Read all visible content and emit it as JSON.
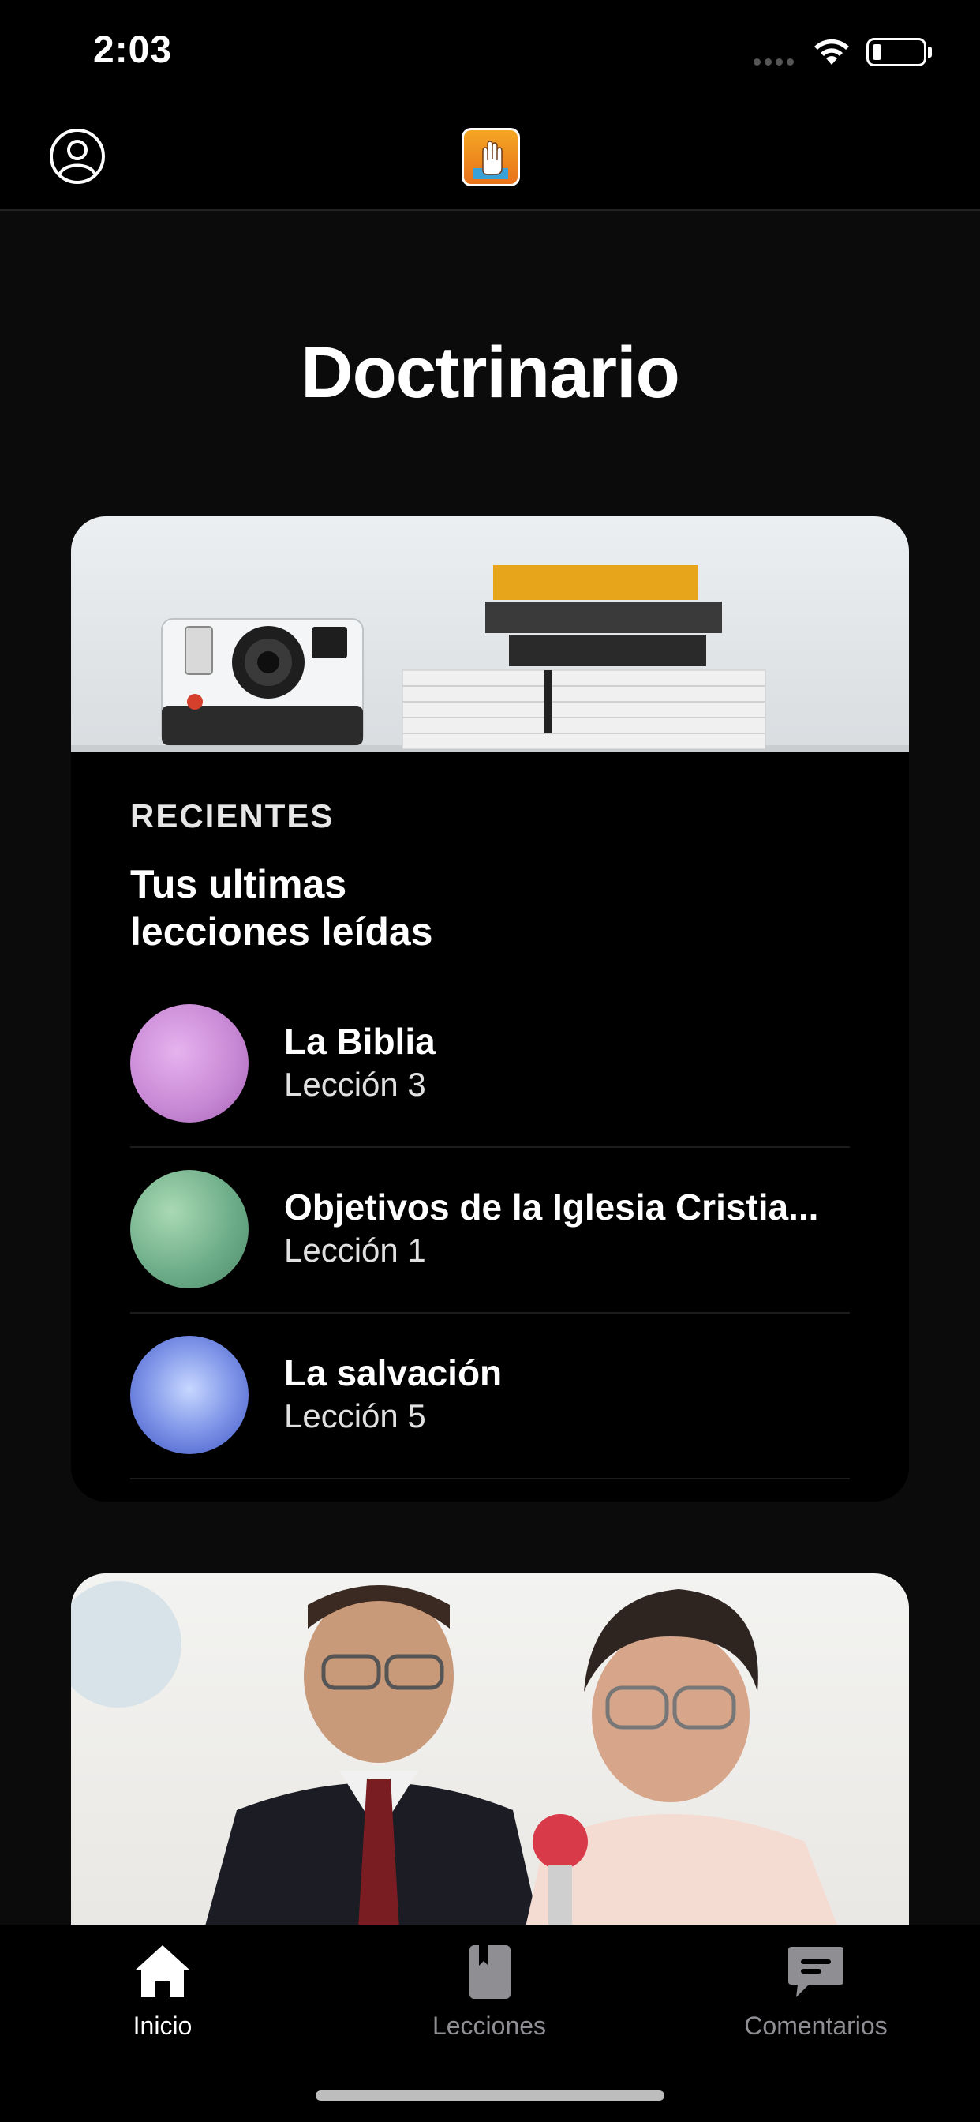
{
  "status_bar": {
    "time": "2:03"
  },
  "header": {
    "app_icon": "hand-raise-icon",
    "profile_icon": "user-circle-icon"
  },
  "page": {
    "title": "Doctrinario"
  },
  "recent": {
    "label": "RECIENTES",
    "title_line1": "Tus ultimas",
    "title_line2": "lecciones leídas",
    "items": [
      {
        "title": "La Biblia",
        "subtitle": "Lección 3",
        "thumb_color": "#c98ad6"
      },
      {
        "title": "Objetivos de la Iglesia Cristia...",
        "subtitle": "Lección 1",
        "thumb_color": "#6fae8a"
      },
      {
        "title": "La salvación",
        "subtitle": "Lección 5",
        "thumb_color": "#5a6fd8"
      }
    ]
  },
  "tabs": [
    {
      "label": "Inicio",
      "icon": "home-icon",
      "active": true
    },
    {
      "label": "Lecciones",
      "icon": "book-icon",
      "active": false
    },
    {
      "label": "Comentarios",
      "icon": "chat-icon",
      "active": false
    }
  ]
}
